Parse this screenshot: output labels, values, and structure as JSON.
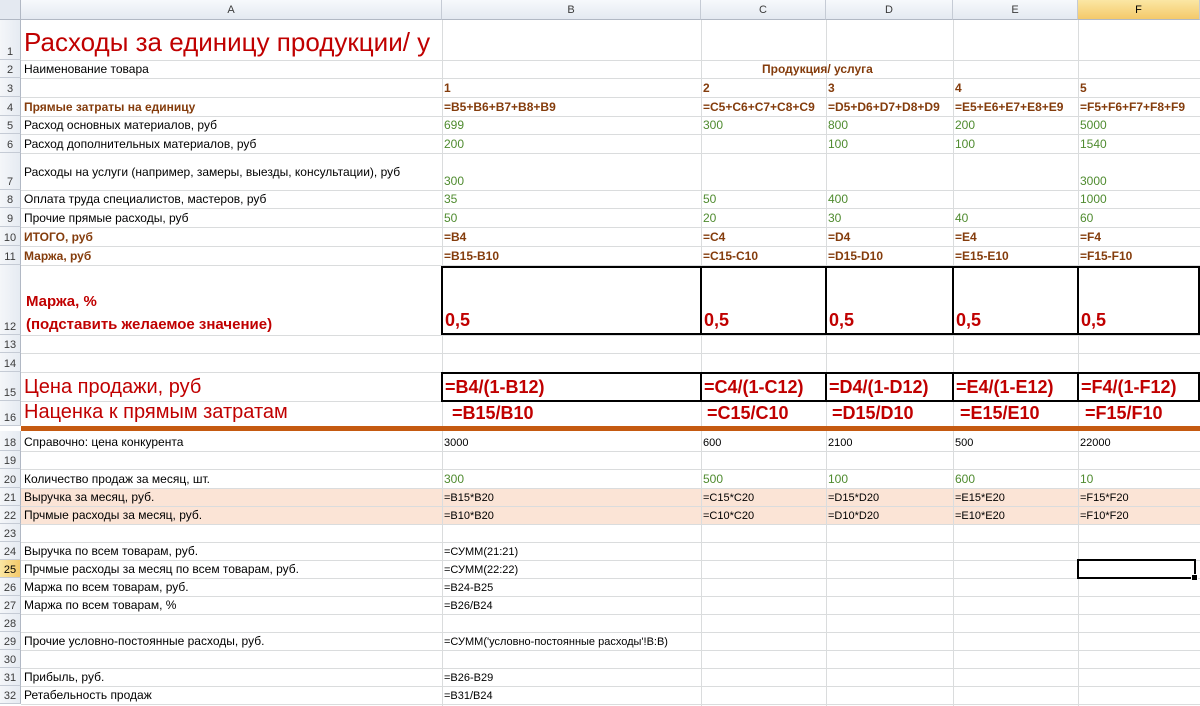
{
  "columns": [
    "A",
    "B",
    "C",
    "D",
    "E",
    "F"
  ],
  "selected_column": "F",
  "selected_row": "25",
  "rows": [
    "1",
    "2",
    "3",
    "4",
    "5",
    "6",
    "7",
    "8",
    "9",
    "10",
    "11",
    "12",
    "13",
    "14",
    "15",
    "16",
    "18",
    "19",
    "20",
    "21",
    "22",
    "23",
    "24",
    "25",
    "26",
    "27",
    "28",
    "29",
    "30",
    "31",
    "32"
  ],
  "sheet": {
    "title": "Расходы за единицу продукции/ у",
    "r2_label": "Наименование товара",
    "r2_header": "Продукция/ услуга",
    "r3": [
      "1",
      "2",
      "3",
      "4",
      "5"
    ],
    "r4_label": "Прямые затраты на единицу",
    "r4": [
      "=B5+B6+B7+B8+B9",
      "=C5+C6+C7+C8+C9",
      "=D5+D6+D7+D8+D9",
      "=E5+E6+E7+E8+E9",
      "=F5+F6+F7+F8+F9"
    ],
    "r5_label": "Расход основных материалов, руб",
    "r5": [
      "699",
      "300",
      "800",
      "200",
      "5000"
    ],
    "r6_label": "Расход дополнительных материалов, руб",
    "r6": [
      "200",
      "",
      "100",
      "100",
      "1540"
    ],
    "r7_label": "Расходы на услуги (например, замеры, выезды, консультации), руб",
    "r7": [
      "300",
      "",
      "",
      "",
      "3000"
    ],
    "r8_label": "Оплата труда специалистов, мастеров, руб",
    "r8": [
      "35",
      "50",
      "400",
      "",
      "1000"
    ],
    "r9_label": "Прочие прямые расходы, руб",
    "r9": [
      "50",
      "20",
      "30",
      "40",
      "60"
    ],
    "r10_label": "ИТОГО, руб",
    "r10": [
      "=B4",
      "=C4",
      "=D4",
      "=E4",
      "=F4"
    ],
    "r11_label": "Маржа, руб",
    "r11": [
      "=B15-B10",
      "=C15-C10",
      "=D15-D10",
      "=E15-E10",
      "=F15-F10"
    ],
    "r12_label_1": "Маржа, %",
    "r12_label_2": "(подставить желаемое значение)",
    "r12": [
      "0,5",
      "0,5",
      "0,5",
      "0,5",
      "0,5"
    ],
    "r15_label": "Цена продажи, руб",
    "r15": [
      "=B4/(1-B12)",
      "=C4/(1-C12)",
      "=D4/(1-D12)",
      "=E4/(1-E12)",
      "=F4/(1-F12)"
    ],
    "r16_label": "Наценка к прямым затратам",
    "r16": [
      "=B15/B10",
      "=C15/C10",
      "=D15/D10",
      "=E15/E10",
      "=F15/F10"
    ],
    "r18_label": "Справочно: цена конкурента",
    "r18": [
      "3000",
      "600",
      "2100",
      "500",
      "22000"
    ],
    "r20_label": "Количество продаж за месяц, шт.",
    "r20": [
      "300",
      "500",
      "100",
      "600",
      "10"
    ],
    "r21_label": "Выручка  за месяц, руб.",
    "r21": [
      "=B15*B20",
      "=C15*C20",
      "=D15*D20",
      "=E15*E20",
      "=F15*F20"
    ],
    "r22_label": "Прчмые расходы за месяц, руб.",
    "r22": [
      "=B10*B20",
      "=C10*C20",
      "=D10*D20",
      "=E10*E20",
      "=F10*F20"
    ],
    "r24_label": "Выручка по всем товарам, руб.",
    "r24": "=СУММ(21:21)",
    "r25_label": "Прчмые расходы за месяц по всем товарам, руб.",
    "r25": "=СУММ(22:22)",
    "r26_label": "Маржа по всем товарам, руб.",
    "r26": "=B24-B25",
    "r27_label": "Маржа по всем товарам, %",
    "r27": "=B26/B24",
    "r29_label": "Прочие условно-постоянные расходы, руб.",
    "r29": "=СУММ('условно-постоянные расходы'!B:B)",
    "r31_label": "Прибыль, руб.",
    "r31": "=B26-B29",
    "r32_label": "Ретабельность продаж",
    "r32": "=B31/B24"
  },
  "colors": {
    "brown": "#843c0c",
    "green": "#4f8b2f",
    "red": "#c00000",
    "pink": "#fbe4d6",
    "orange": "#c55a11"
  }
}
